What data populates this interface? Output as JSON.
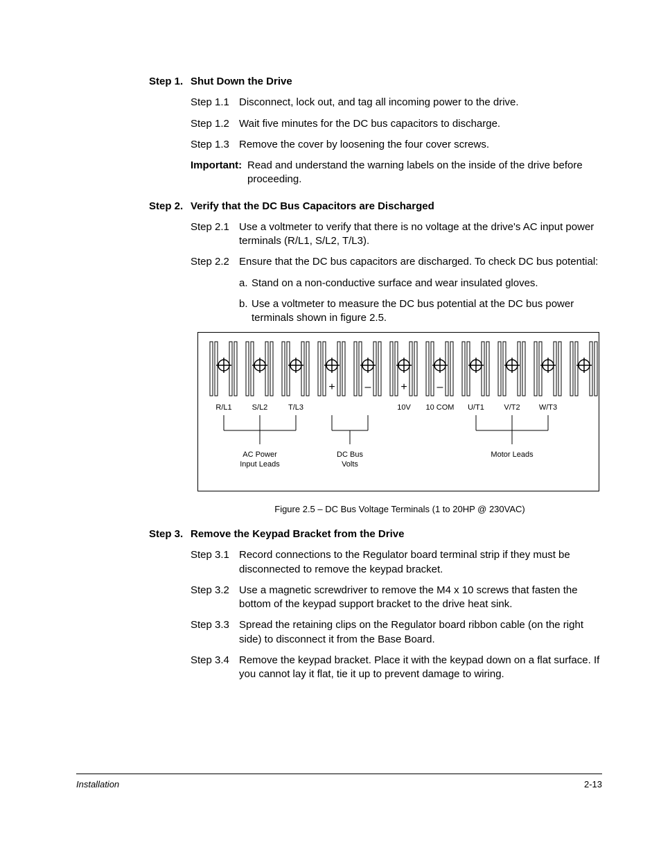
{
  "footer": {
    "section": "Installation",
    "page": "2-13"
  },
  "steps": [
    {
      "num": "Step 1.",
      "title": "Shut Down the Drive",
      "subs": [
        {
          "num": "Step 1.1",
          "text": "Disconnect, lock out, and tag all incoming power to the drive."
        },
        {
          "num": "Step 1.2",
          "text": "Wait five minutes for the DC bus capacitors to discharge."
        },
        {
          "num": "Step 1.3",
          "text": "Remove the cover by loosening the four cover screws."
        }
      ],
      "important": {
        "label": "Important:",
        "text": "Read and understand the warning labels on the inside of the drive before proceeding."
      }
    },
    {
      "num": "Step 2.",
      "title": "Verify that the DC Bus Capacitors are Discharged",
      "subs": [
        {
          "num": "Step 2.1",
          "text": "Use a voltmeter to verify that there is no voltage at the drive's AC input power terminals (R/L1, S/L2, T/L3)."
        },
        {
          "num": "Step 2.2",
          "text": "Ensure that the DC bus capacitors are discharged. To check DC bus potential:"
        }
      ],
      "lettered": [
        {
          "id": "a.",
          "text": "Stand on a non-conductive surface and wear insulated gloves."
        },
        {
          "id": "b.",
          "text": "Use a voltmeter to measure the DC bus potential at the DC bus power terminals shown in figure 2.5."
        }
      ]
    },
    {
      "num": "Step 3.",
      "title": "Remove the Keypad Bracket from the Drive",
      "subs": [
        {
          "num": "Step 3.1",
          "text": "Record connections to the Regulator board terminal strip if they must be disconnected to remove the keypad bracket."
        },
        {
          "num": "Step 3.2",
          "text": "Use a magnetic screwdriver to remove the M4 x 10 screws that fasten the bottom of the keypad support bracket to the drive heat sink."
        },
        {
          "num": "Step 3.3",
          "text": "Spread the retaining clips on the Regulator board ribbon cable (on the right side) to disconnect it from the Base Board."
        },
        {
          "num": "Step 3.4",
          "text": "Remove the keypad bracket. Place it with the keypad down on a flat surface. If you cannot lay it flat, tie it up to prevent damage to wiring."
        }
      ]
    }
  ],
  "figure": {
    "caption": "Figure 2.5 – DC Bus Voltage Terminals (1 to 20HP @ 230VAC)",
    "terminals": [
      "R/L1",
      "S/L2",
      "T/L3",
      "",
      "",
      "",
      "",
      "",
      "",
      "",
      ""
    ],
    "term_top_labels": [
      "R/L1",
      "S/L2",
      "T/L3",
      "10V",
      "10 COM",
      "U/T1",
      "V/T2",
      "W/T3"
    ],
    "polarity": [
      "",
      "",
      "",
      "+",
      "–",
      "+",
      "–",
      "",
      "",
      "",
      ""
    ],
    "groups": [
      {
        "label": "AC Power\nInput Leads"
      },
      {
        "label": "DC Bus\nVolts"
      },
      {
        "label": "Motor Leads"
      }
    ]
  }
}
